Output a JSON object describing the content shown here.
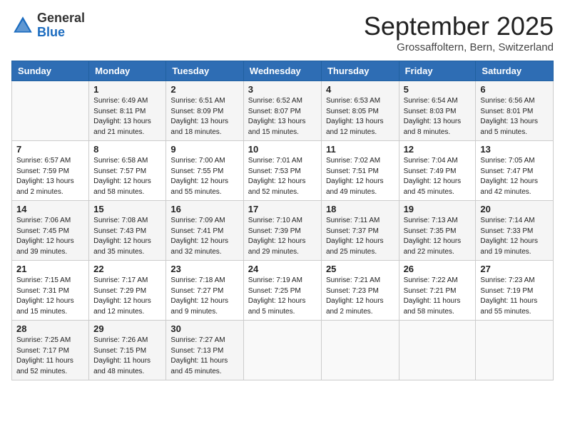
{
  "logo": {
    "general": "General",
    "blue": "Blue"
  },
  "header": {
    "month": "September 2025",
    "location": "Grossaffoltern, Bern, Switzerland"
  },
  "days_of_week": [
    "Sunday",
    "Monday",
    "Tuesday",
    "Wednesday",
    "Thursday",
    "Friday",
    "Saturday"
  ],
  "weeks": [
    [
      {
        "num": "",
        "info": ""
      },
      {
        "num": "1",
        "info": "Sunrise: 6:49 AM\nSunset: 8:11 PM\nDaylight: 13 hours\nand 21 minutes."
      },
      {
        "num": "2",
        "info": "Sunrise: 6:51 AM\nSunset: 8:09 PM\nDaylight: 13 hours\nand 18 minutes."
      },
      {
        "num": "3",
        "info": "Sunrise: 6:52 AM\nSunset: 8:07 PM\nDaylight: 13 hours\nand 15 minutes."
      },
      {
        "num": "4",
        "info": "Sunrise: 6:53 AM\nSunset: 8:05 PM\nDaylight: 13 hours\nand 12 minutes."
      },
      {
        "num": "5",
        "info": "Sunrise: 6:54 AM\nSunset: 8:03 PM\nDaylight: 13 hours\nand 8 minutes."
      },
      {
        "num": "6",
        "info": "Sunrise: 6:56 AM\nSunset: 8:01 PM\nDaylight: 13 hours\nand 5 minutes."
      }
    ],
    [
      {
        "num": "7",
        "info": "Sunrise: 6:57 AM\nSunset: 7:59 PM\nDaylight: 13 hours\nand 2 minutes."
      },
      {
        "num": "8",
        "info": "Sunrise: 6:58 AM\nSunset: 7:57 PM\nDaylight: 12 hours\nand 58 minutes."
      },
      {
        "num": "9",
        "info": "Sunrise: 7:00 AM\nSunset: 7:55 PM\nDaylight: 12 hours\nand 55 minutes."
      },
      {
        "num": "10",
        "info": "Sunrise: 7:01 AM\nSunset: 7:53 PM\nDaylight: 12 hours\nand 52 minutes."
      },
      {
        "num": "11",
        "info": "Sunrise: 7:02 AM\nSunset: 7:51 PM\nDaylight: 12 hours\nand 49 minutes."
      },
      {
        "num": "12",
        "info": "Sunrise: 7:04 AM\nSunset: 7:49 PM\nDaylight: 12 hours\nand 45 minutes."
      },
      {
        "num": "13",
        "info": "Sunrise: 7:05 AM\nSunset: 7:47 PM\nDaylight: 12 hours\nand 42 minutes."
      }
    ],
    [
      {
        "num": "14",
        "info": "Sunrise: 7:06 AM\nSunset: 7:45 PM\nDaylight: 12 hours\nand 39 minutes."
      },
      {
        "num": "15",
        "info": "Sunrise: 7:08 AM\nSunset: 7:43 PM\nDaylight: 12 hours\nand 35 minutes."
      },
      {
        "num": "16",
        "info": "Sunrise: 7:09 AM\nSunset: 7:41 PM\nDaylight: 12 hours\nand 32 minutes."
      },
      {
        "num": "17",
        "info": "Sunrise: 7:10 AM\nSunset: 7:39 PM\nDaylight: 12 hours\nand 29 minutes."
      },
      {
        "num": "18",
        "info": "Sunrise: 7:11 AM\nSunset: 7:37 PM\nDaylight: 12 hours\nand 25 minutes."
      },
      {
        "num": "19",
        "info": "Sunrise: 7:13 AM\nSunset: 7:35 PM\nDaylight: 12 hours\nand 22 minutes."
      },
      {
        "num": "20",
        "info": "Sunrise: 7:14 AM\nSunset: 7:33 PM\nDaylight: 12 hours\nand 19 minutes."
      }
    ],
    [
      {
        "num": "21",
        "info": "Sunrise: 7:15 AM\nSunset: 7:31 PM\nDaylight: 12 hours\nand 15 minutes."
      },
      {
        "num": "22",
        "info": "Sunrise: 7:17 AM\nSunset: 7:29 PM\nDaylight: 12 hours\nand 12 minutes."
      },
      {
        "num": "23",
        "info": "Sunrise: 7:18 AM\nSunset: 7:27 PM\nDaylight: 12 hours\nand 9 minutes."
      },
      {
        "num": "24",
        "info": "Sunrise: 7:19 AM\nSunset: 7:25 PM\nDaylight: 12 hours\nand 5 minutes."
      },
      {
        "num": "25",
        "info": "Sunrise: 7:21 AM\nSunset: 7:23 PM\nDaylight: 12 hours\nand 2 minutes."
      },
      {
        "num": "26",
        "info": "Sunrise: 7:22 AM\nSunset: 7:21 PM\nDaylight: 11 hours\nand 58 minutes."
      },
      {
        "num": "27",
        "info": "Sunrise: 7:23 AM\nSunset: 7:19 PM\nDaylight: 11 hours\nand 55 minutes."
      }
    ],
    [
      {
        "num": "28",
        "info": "Sunrise: 7:25 AM\nSunset: 7:17 PM\nDaylight: 11 hours\nand 52 minutes."
      },
      {
        "num": "29",
        "info": "Sunrise: 7:26 AM\nSunset: 7:15 PM\nDaylight: 11 hours\nand 48 minutes."
      },
      {
        "num": "30",
        "info": "Sunrise: 7:27 AM\nSunset: 7:13 PM\nDaylight: 11 hours\nand 45 minutes."
      },
      {
        "num": "",
        "info": ""
      },
      {
        "num": "",
        "info": ""
      },
      {
        "num": "",
        "info": ""
      },
      {
        "num": "",
        "info": ""
      }
    ]
  ]
}
